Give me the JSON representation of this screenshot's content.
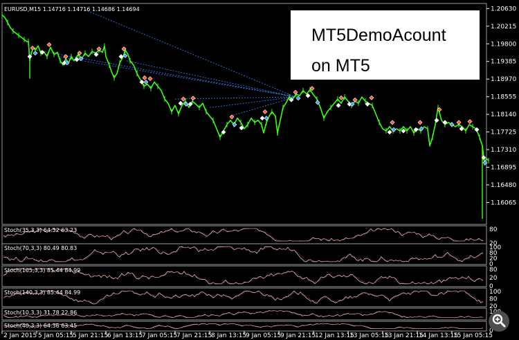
{
  "chart": {
    "symbol_label": "EURUSD,M15  1.14716 1.14716 1.14686 1.14694",
    "main_price_min": 1.1555,
    "main_price_max": 1.2075,
    "price_ticks": [
      "1.20630",
      "1.20215",
      "1.19800",
      "1.19385",
      "1.18970",
      "1.18555",
      "1.18140",
      "1.17725",
      "1.17310",
      "1.16895",
      "1.16480",
      "1.16065"
    ],
    "time_labels": [
      "2 Jan 2015",
      "5 Jan 05:15",
      "5 Jan 21:15",
      "6 Jan 13:15",
      "7 Jan 05:15",
      "7 Jan 21:15",
      "8 Jan 13:15",
      "9 Jan 05:15",
      "9 Jan 21:15",
      "12 Jan 13:15",
      "13 Jan 05:15",
      "13 Jan 21:15",
      "14 Jan 13:15",
      "15 Jan 05:15"
    ],
    "price_path": [
      [
        0,
        1.2048
      ],
      [
        4,
        1.2042
      ],
      [
        8,
        1.203
      ],
      [
        12,
        1.2018
      ],
      [
        16,
        1.201
      ],
      [
        20,
        1.2005
      ],
      [
        24,
        1.2
      ],
      [
        28,
        1.1995
      ],
      [
        32,
        1.199
      ],
      [
        36,
        1.1985
      ],
      [
        38,
        1.1986
      ],
      [
        40,
        1.194
      ],
      [
        42,
        1.1955
      ],
      [
        45,
        1.1972
      ],
      [
        48,
        1.1965
      ],
      [
        52,
        1.1975
      ],
      [
        56,
        1.1958
      ],
      [
        60,
        1.1962
      ],
      [
        65,
        1.195
      ],
      [
        70,
        1.1972
      ],
      [
        75,
        1.1955
      ],
      [
        80,
        1.196
      ],
      [
        84,
        1.194
      ],
      [
        88,
        1.193
      ],
      [
        92,
        1.1945
      ],
      [
        96,
        1.1935
      ],
      [
        100,
        1.195
      ],
      [
        104,
        1.194
      ],
      [
        110,
        1.1955
      ],
      [
        115,
        1.1945
      ],
      [
        120,
        1.1958
      ],
      [
        125,
        1.195
      ],
      [
        130,
        1.1962
      ],
      [
        135,
        1.1958
      ],
      [
        140,
        1.1965
      ],
      [
        145,
        1.196
      ],
      [
        148,
        1.1975
      ],
      [
        150,
        1.195
      ],
      [
        155,
        1.193
      ],
      [
        158,
        1.1915
      ],
      [
        162,
        1.19
      ],
      [
        166,
        1.191
      ],
      [
        170,
        1.1935
      ],
      [
        175,
        1.195
      ],
      [
        178,
        1.1965
      ],
      [
        182,
        1.1955
      ],
      [
        185,
        1.194
      ],
      [
        190,
        1.193
      ],
      [
        195,
        1.191
      ],
      [
        200,
        1.1895
      ],
      [
        205,
        1.188
      ],
      [
        210,
        1.1885
      ],
      [
        215,
        1.1875
      ],
      [
        220,
        1.189
      ],
      [
        225,
        1.188
      ],
      [
        230,
        1.187
      ],
      [
        235,
        1.185
      ],
      [
        240,
        1.184
      ],
      [
        245,
        1.182
      ],
      [
        250,
        1.1835
      ],
      [
        255,
        1.1815
      ],
      [
        260,
        1.1835
      ],
      [
        265,
        1.1845
      ],
      [
        270,
        1.183
      ],
      [
        275,
        1.1845
      ],
      [
        280,
        1.1838
      ],
      [
        285,
        1.183
      ],
      [
        290,
        1.184
      ],
      [
        295,
        1.182
      ],
      [
        300,
        1.181
      ],
      [
        305,
        1.18
      ],
      [
        310,
        1.178
      ],
      [
        315,
        1.176
      ],
      [
        320,
        1.1775
      ],
      [
        325,
        1.179
      ],
      [
        330,
        1.18
      ],
      [
        335,
        1.179
      ],
      [
        340,
        1.1805
      ],
      [
        345,
        1.1795
      ],
      [
        350,
        1.178
      ],
      [
        355,
        1.179
      ],
      [
        360,
        1.1805
      ],
      [
        365,
        1.1795
      ],
      [
        370,
        1.18
      ],
      [
        375,
        1.179
      ],
      [
        378,
        1.177
      ],
      [
        382,
        1.1795
      ],
      [
        386,
        1.181
      ],
      [
        390,
        1.182
      ],
      [
        395,
        1.181
      ],
      [
        398,
        1.177
      ],
      [
        402,
        1.18
      ],
      [
        406,
        1.183
      ],
      [
        410,
        1.184
      ],
      [
        415,
        1.1855
      ],
      [
        420,
        1.185
      ],
      [
        425,
        1.1862
      ],
      [
        430,
        1.1858
      ],
      [
        435,
        1.187
      ],
      [
        440,
        1.1862
      ],
      [
        445,
        1.1872
      ],
      [
        450,
        1.186
      ],
      [
        455,
        1.185
      ],
      [
        460,
        1.183
      ],
      [
        465,
        1.1805
      ],
      [
        470,
        1.182
      ],
      [
        475,
        1.183
      ],
      [
        480,
        1.184
      ],
      [
        485,
        1.185
      ],
      [
        490,
        1.184
      ],
      [
        495,
        1.1855
      ],
      [
        500,
        1.1845
      ],
      [
        505,
        1.1835
      ],
      [
        510,
        1.1845
      ],
      [
        515,
        1.184
      ],
      [
        520,
        1.1855
      ],
      [
        525,
        1.1845
      ],
      [
        530,
        1.184
      ],
      [
        535,
        1.1835
      ],
      [
        540,
        1.1815
      ],
      [
        545,
        1.1795
      ],
      [
        550,
        1.178
      ],
      [
        555,
        1.1775
      ],
      [
        560,
        1.1785
      ],
      [
        565,
        1.1775
      ],
      [
        570,
        1.178
      ],
      [
        575,
        1.1775
      ],
      [
        580,
        1.1785
      ],
      [
        585,
        1.1775
      ],
      [
        590,
        1.1785
      ],
      [
        595,
        1.177
      ],
      [
        600,
        1.178
      ],
      [
        605,
        1.1775
      ],
      [
        610,
        1.1785
      ],
      [
        615,
        1.178
      ],
      [
        618,
        1.174
      ],
      [
        622,
        1.176
      ],
      [
        626,
        1.179
      ],
      [
        630,
        1.183
      ],
      [
        635,
        1.18
      ],
      [
        640,
        1.179
      ],
      [
        645,
        1.1795
      ],
      [
        650,
        1.179
      ],
      [
        655,
        1.1785
      ],
      [
        660,
        1.179
      ],
      [
        665,
        1.1785
      ],
      [
        670,
        1.1775
      ],
      [
        675,
        1.179
      ],
      [
        680,
        1.1785
      ],
      [
        685,
        1.178
      ],
      [
        690,
        1.176
      ],
      [
        694,
        1.174
      ],
      [
        697,
        1.17
      ],
      [
        700,
        1.171
      ],
      [
        703,
        1.1705
      ]
    ],
    "spikes": [
      [
        40,
        1.1898
      ],
      [
        398,
        1.1765
      ],
      [
        618,
        1.1738
      ],
      [
        694,
        1.1568
      ]
    ],
    "markers_red": [
      [
        44,
        1.197
      ],
      [
        68,
        1.1978
      ],
      [
        92,
        1.195
      ],
      [
        112,
        1.1958
      ],
      [
        140,
        1.1968
      ],
      [
        176,
        1.1968
      ],
      [
        206,
        1.19
      ],
      [
        214,
        1.1898
      ],
      [
        262,
        1.185
      ],
      [
        276,
        1.1852
      ],
      [
        332,
        1.1808
      ],
      [
        380,
        1.182
      ],
      [
        424,
        1.1866
      ],
      [
        448,
        1.1875
      ],
      [
        490,
        1.1853
      ],
      [
        510,
        1.1848
      ],
      [
        534,
        1.1853
      ],
      [
        564,
        1.1795
      ],
      [
        604,
        1.1795
      ],
      [
        632,
        1.1825
      ],
      [
        660,
        1.1795
      ],
      [
        676,
        1.1797
      ]
    ],
    "markers_white": [
      [
        40,
        1.195
      ],
      [
        58,
        1.196
      ],
      [
        90,
        1.1935
      ],
      [
        108,
        1.1943
      ],
      [
        136,
        1.1955
      ],
      [
        172,
        1.195
      ],
      [
        202,
        1.189
      ],
      [
        258,
        1.184
      ],
      [
        272,
        1.1838
      ],
      [
        320,
        1.1772
      ],
      [
        346,
        1.1782
      ],
      [
        376,
        1.1805
      ],
      [
        418,
        1.1848
      ],
      [
        442,
        1.1858
      ],
      [
        486,
        1.1835
      ],
      [
        502,
        1.1838
      ],
      [
        528,
        1.1838
      ],
      [
        560,
        1.1772
      ],
      [
        580,
        1.1775
      ],
      [
        598,
        1.1778
      ],
      [
        628,
        1.18
      ],
      [
        640,
        1.1795
      ],
      [
        664,
        1.178
      ],
      [
        686,
        1.1778
      ],
      [
        696,
        1.1712
      ]
    ],
    "markers_blue": [
      [
        48,
        1.1958
      ],
      [
        94,
        1.1935
      ],
      [
        114,
        1.1945
      ],
      [
        178,
        1.1952
      ],
      [
        208,
        1.189
      ],
      [
        266,
        1.1838
      ],
      [
        336,
        1.179
      ],
      [
        382,
        1.1805
      ],
      [
        428,
        1.1852
      ],
      [
        456,
        1.1842
      ],
      [
        506,
        1.1838
      ],
      [
        566,
        1.1778
      ],
      [
        606,
        1.178
      ],
      [
        650,
        1.179
      ],
      [
        698,
        1.17
      ]
    ],
    "dashed_lines": [
      [
        [
          120,
          1.206
        ],
        [
          424,
          1.1855
        ]
      ],
      [
        [
          50,
          1.1965
        ],
        [
          424,
          1.1855
        ]
      ],
      [
        [
          80,
          1.195
        ],
        [
          424,
          1.1855
        ]
      ],
      [
        [
          180,
          1.194
        ],
        [
          424,
          1.1855
        ]
      ],
      [
        [
          250,
          1.185
        ],
        [
          424,
          1.1855
        ]
      ],
      [
        [
          300,
          1.183
        ],
        [
          424,
          1.1855
        ]
      ],
      [
        [
          330,
          1.181
        ],
        [
          424,
          1.1855
        ]
      ]
    ],
    "overlay_line1": "MT5DemoAcount",
    "overlay_line2": "on MT5"
  },
  "indicators": [
    {
      "label": "Stoch(35,3,3) 64.32 63.23",
      "levels": [
        "80",
        "20"
      ]
    },
    {
      "label": "Stoch(70,3,3) 80.49 80.83",
      "levels": [
        "100",
        "80",
        "20",
        "0"
      ]
    },
    {
      "label": "Stoch(105,3,3) 85.44 84.99",
      "levels": [
        "80",
        "20",
        "0"
      ]
    },
    {
      "label": "Stoch(140,3,3) 85.44 84.99",
      "levels": [
        "100",
        "80",
        "20"
      ]
    },
    {
      "label": "Stoch(10,3,3) 31.78 22.86",
      "levels": [
        "100",
        "0"
      ]
    },
    {
      "label": "Stoch(40,3,3) 64.36 63.45",
      "levels": [
        "100",
        "0"
      ]
    }
  ],
  "colors": {
    "price": "#39ff14",
    "marker_red": "#ff5533",
    "marker_white": "#ffffff",
    "marker_blue": "#3aa0ff",
    "dashed": "#2f6fd6",
    "stoch_main": "#c8c8c8",
    "stoch_signal": "#d0342c"
  },
  "icons": {
    "zoom_control": "magnifier-zoom-icon"
  }
}
